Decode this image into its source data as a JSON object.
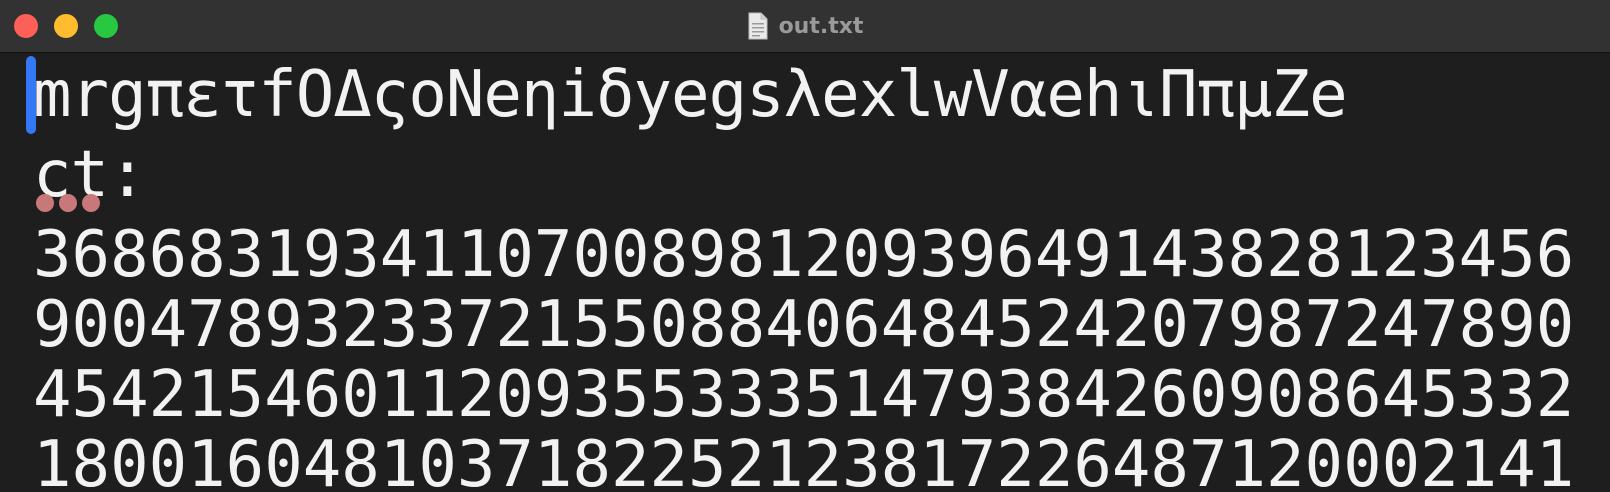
{
  "window": {
    "title": "out.txt"
  },
  "editor": {
    "lines": [
      "mrgπετfOΔςoNeηiδyegsλexlwVαehιΠπμZe",
      "ct:",
      "3686831934110700898120939649143828123456",
      "9004789323372155088406484524207987247890",
      "4542154601120935533351479384260908645332",
      "1800160481037182252123817226487120002141"
    ]
  },
  "colors": {
    "background": "#1e1e1e",
    "titlebar": "#323232",
    "text": "#f2f2f2",
    "caret": "#3478f6",
    "close": "#fe5f57",
    "minimize": "#febc2e",
    "maximize": "#28c840",
    "spellcheck": "#c87878"
  }
}
